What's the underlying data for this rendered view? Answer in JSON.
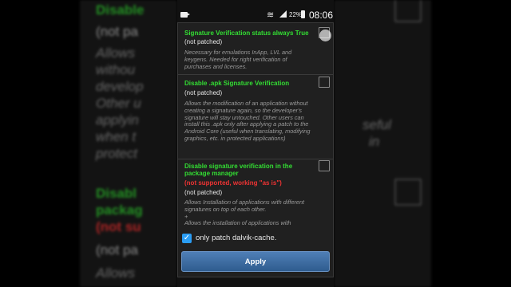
{
  "status_bar": {
    "battery": "22%",
    "time": "08:06",
    "icons": [
      "video-cam-icon",
      "wifi-icon",
      "signal-icon",
      "battery-icon"
    ]
  },
  "options": [
    {
      "title": "Signature Verification status always True",
      "state": "(not patched)",
      "description": "Necessary for emulations InApp, LVL and keygens. Needed for right verification of purchases and licenses."
    },
    {
      "title": "Disable .apk Signature Verification",
      "state": "(not patched)",
      "description": "Allows the modification of an application without creating a signature again, so the developer's signature will stay untouched. Other users can install this .apk only after applying a patch to the Android Core (useful when translating, modifying graphics, etc. in protected applications)"
    },
    {
      "title": "Disable signature verification in the package manager",
      "warning": "(not supported, working \"as is\")",
      "state": "(not patched)",
      "description": "Allows Installation of applications with different signatures on top of each other.\n+\nAllows the installation of applications with"
    }
  ],
  "dalvik_checkbox": {
    "label": "only patch dalvik-cache.",
    "checked": true
  },
  "apply_button": "Apply",
  "background": {
    "left_lines": [
      {
        "text": "Disable",
        "style": "g"
      },
      {
        "text": "(not pa",
        "style": "w"
      },
      {
        "text": "Allows",
        "style": "i"
      },
      {
        "text": "withou",
        "style": "i"
      },
      {
        "text": "develop",
        "style": "i"
      },
      {
        "text": "Other u",
        "style": "i"
      },
      {
        "text": "applyin",
        "style": "i"
      },
      {
        "text": "when t",
        "style": "i"
      },
      {
        "text": "protect",
        "style": "i"
      }
    ],
    "left_lines2": [
      {
        "text": "Disabl",
        "style": "g"
      },
      {
        "text": "packag",
        "style": "g"
      },
      {
        "text": "(not su",
        "style": "r"
      },
      {
        "text": "(not pa",
        "style": "w"
      },
      {
        "text": "Allows",
        "style": "i"
      }
    ],
    "right_lines": [
      {
        "text": "seful",
        "style": "i"
      },
      {
        "text": "in",
        "style": "i"
      }
    ]
  },
  "colors": {
    "title_green": "#33dd33",
    "warning_red": "#ee3333",
    "accent_blue": "#2a9df4"
  }
}
